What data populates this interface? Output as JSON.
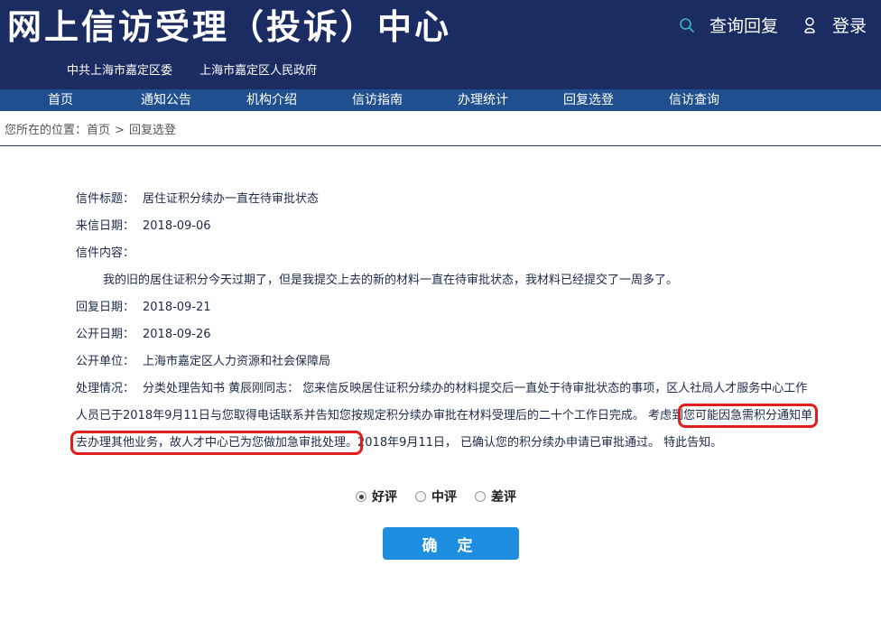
{
  "header": {
    "site_title": "网上信访受理（投诉）中心",
    "orgs": [
      "中共上海市嘉定区委",
      "上海市嘉定区人民政府"
    ],
    "query_reply_label": "查询回复",
    "login_label": "登录"
  },
  "nav": {
    "items": [
      "首页",
      "通知公告",
      "机构介绍",
      "信访指南",
      "办理统计",
      "回复选登",
      "信访查询"
    ]
  },
  "breadcrumb": {
    "prefix": "您所在的位置：",
    "home": "首页",
    "separator": ">",
    "current": "回复选登"
  },
  "letter": {
    "title_label": "信件标题：",
    "title": "居住证积分续办一直在待审批状态",
    "date_label": "来信日期：",
    "date": "2018-09-06",
    "content_label": "信件内容：",
    "content": "我的旧的居住证积分今天过期了，但是我提交上去的新的材料一直在待审批状态，我材料已经提交了一周多了。",
    "reply_date_label": "回复日期：",
    "reply_date": "2018-09-21",
    "public_date_label": "公开日期：",
    "public_date": "2018-09-26",
    "unit_label": "公开单位：",
    "unit": "上海市嘉定区人力资源和社会保障局",
    "handling_label": "处理情况：",
    "handling_part1": "分类处理告知书 黄辰刚同志： 您来信反映居住证积分续办的材料提交后一直处于待审批状态的事项，区人社局人才服务中心工作人员已于2018年9月11日与您取得电话联系并告知您按规定积分续办审批在材料受理后的二十个工作日完成。 考虑到",
    "handling_highlight": "您可能因急需积分通知单去办理其他业务，故人才中心已为您做加急审批处理。",
    "handling_part2": "2018年9月11日， 已确认您的积分续办申请已审批通过。 特此告知。"
  },
  "rating": {
    "options": [
      "好评",
      "中评",
      "差评"
    ],
    "selected": "好评"
  },
  "confirm_label": "确 定",
  "colors": {
    "header_bg": "#1b2c63",
    "nav_bg": "#1f4f8f",
    "button_bg": "#1e8ee0",
    "highlight_border": "#e21d1d",
    "search_icon": "#3fb6c7"
  }
}
